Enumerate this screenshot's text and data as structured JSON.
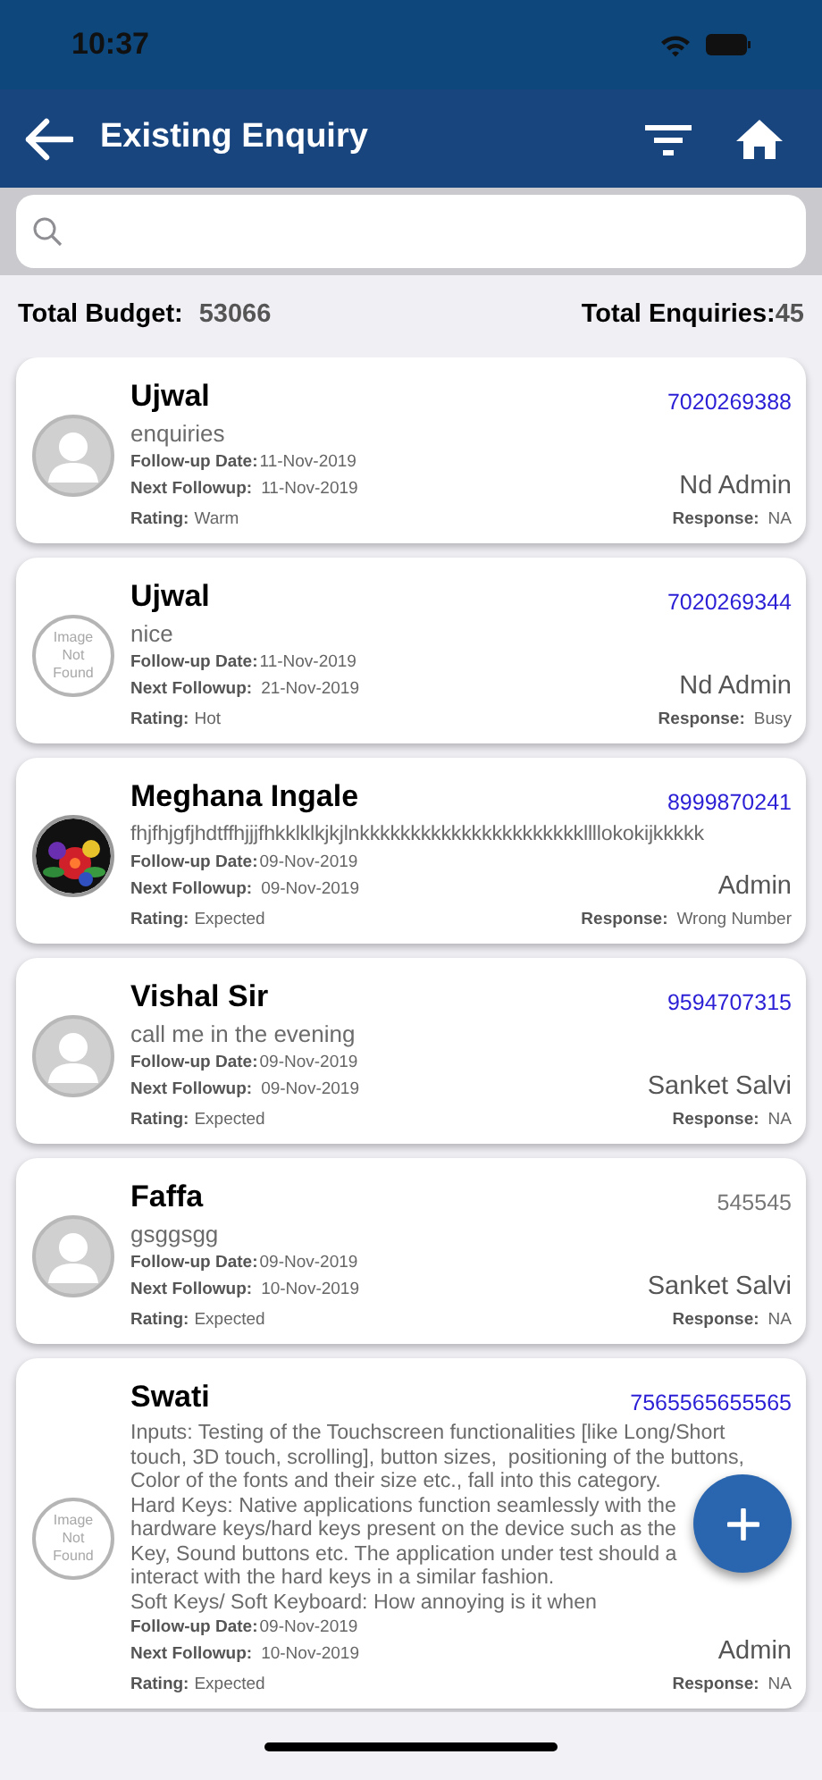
{
  "status_bar": {
    "time": "10:37"
  },
  "header": {
    "title": "Existing Enquiry"
  },
  "totals": {
    "budget_label": "Total Budget:",
    "budget_value": "53066",
    "enquiries_label": "Total Enquiries:",
    "enquiries_value": "45"
  },
  "enquiries": [
    {
      "name": "Ujwal",
      "avatar": {
        "kind": "placeholder"
      },
      "description": [
        "enquiries"
      ],
      "followup_label": "Follow-up Date:",
      "followup": "11-Nov-2019",
      "next_label": "Next Followup:",
      "next": "11-Nov-2019",
      "rating_label": "Rating:",
      "rating": "Warm",
      "phone": {
        "text": "7020269388",
        "color": "#2b1fd6"
      },
      "owner": "Nd Admin",
      "response_label": "Response:",
      "response": "NA"
    },
    {
      "name": "Ujwal",
      "avatar": {
        "kind": "not_found",
        "text": [
          "Image",
          "Not",
          "Found"
        ]
      },
      "description": [
        "nice"
      ],
      "followup_label": "Follow-up Date:",
      "followup": "11-Nov-2019",
      "next_label": "Next Followup:",
      "next": "21-Nov-2019",
      "rating_label": "Rating:",
      "rating": "Hot",
      "phone": {
        "text": "7020269344",
        "color": "#2b1fd6"
      },
      "owner": "Nd Admin",
      "response_label": "Response:",
      "response": "Busy"
    },
    {
      "name": "Meghana Ingale",
      "description": [
        "fhjfhjgfjhdtffhjjjfhkklklkjkjlnkkkkkkkkkkkkkkkkkkkkkkllllokokijkkkkk"
      ],
      "followup_label": "Follow-up Date:",
      "followup": "09-Nov-2019",
      "next_label": "Next Followup:",
      "next": "09-Nov-2019",
      "rating_label": "Rating:",
      "rating": "Expected",
      "phone": {
        "text": "8999870241",
        "color": "#2b1fd6"
      },
      "owner": "Admin",
      "response_label": "Response:",
      "response": "Wrong Number"
    },
    {
      "name": "Vishal Sir",
      "avatar": {
        "kind": "placeholder"
      },
      "description": [
        "call me in the evening"
      ],
      "followup_label": "Follow-up Date:",
      "followup": "09-Nov-2019",
      "next_label": "Next Followup:",
      "next": "09-Nov-2019",
      "rating_label": "Rating:",
      "rating": "Expected",
      "phone": {
        "text": "9594707315",
        "color": "#2b1fd6"
      },
      "owner": "Sanket Salvi",
      "response_label": "Response:",
      "response": "NA"
    },
    {
      "name": "Faffa",
      "avatar": {
        "kind": "placeholder"
      },
      "description": [
        "gsggsgg"
      ],
      "followup_label": "Follow-up Date:",
      "followup": "09-Nov-2019",
      "next_label": "Next Followup:",
      "next": "10-Nov-2019",
      "rating_label": "Rating:",
      "rating": "Expected",
      "phone": {
        "text": "545545",
        "color": "#777777"
      },
      "owner": "Sanket Salvi",
      "response_label": "Response:",
      "response": "NA"
    },
    {
      "name": "Swati",
      "avatar": {
        "kind": "not_found",
        "text": [
          "Image",
          "Not",
          "Found"
        ]
      },
      "description": [
        "Inputs: Testing of the Touchscreen functionalities [like Long/Short",
        "touch, 3D touch, scrolling], button sizes,  positioning of the buttons,",
        "Color of the fonts and their size etc., fall into this category.",
        "Hard Keys: Native applications function seamlessly with the",
        "hardware keys/hard keys present on the device such as the",
        "Key, Sound buttons etc. The application under test should a",
        "interact with the hard keys in a similar fashion.",
        "Soft Keys/ Soft Keyboard: How annoying is it when"
      ],
      "followup_label": "Follow-up Date:",
      "followup": "09-Nov-2019",
      "next_label": "Next Followup:",
      "next": "10-Nov-2019",
      "rating_label": "Rating:",
      "rating": "Expected",
      "phone": {
        "text": "7565565655565",
        "color": "#2b1fd6"
      },
      "owner": "Admin",
      "response_label": "Response:",
      "response": "NA"
    }
  ]
}
